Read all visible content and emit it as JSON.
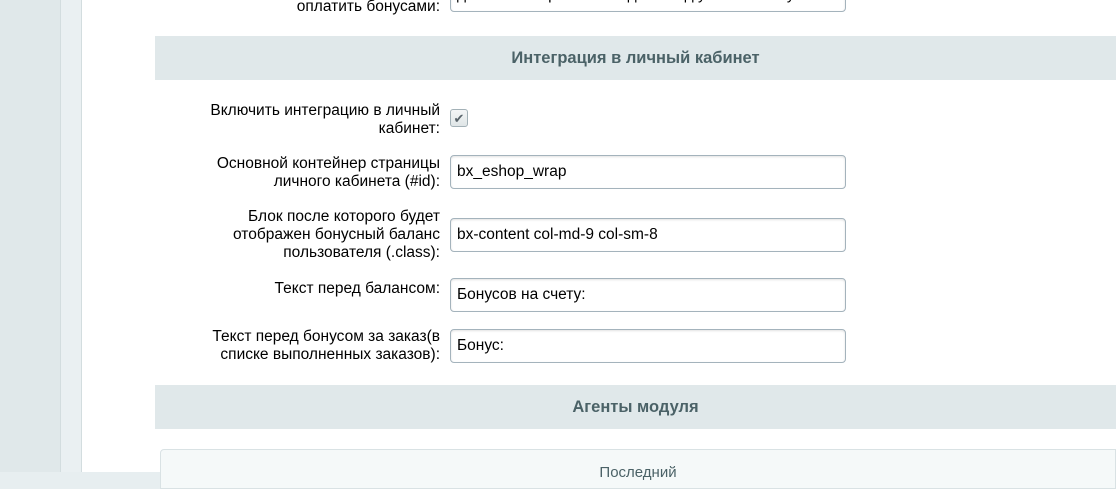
{
  "top_row": {
    "label": "оплатить бонусами:",
    "value": "данные товары не попадают под условия бонусной"
  },
  "section_integration": {
    "title": "Интеграция в личный кабинет"
  },
  "fields": {
    "enable": {
      "label_l1": "Включить интеграцию в личный",
      "label_l2": "кабинет:",
      "checked": true
    },
    "container": {
      "label_l1": "Основной контейнер страницы",
      "label_l2": "личного кабинета (#id):",
      "value": "bx_eshop_wrap"
    },
    "block": {
      "label_l1": "Блок после которого будет",
      "label_l2": "отображен бонусный баланс",
      "label_l3": "пользователя (.class):",
      "value": "bx-content col-md-9 col-sm-8"
    },
    "balance_text": {
      "label": "Текст перед балансом:",
      "value": "Бонусов на счету:"
    },
    "order_bonus_text": {
      "label_l1": "Текст перед бонусом за заказ(в",
      "label_l2": "списке выполненных заказов):",
      "value": "Бонус:"
    }
  },
  "section_agents": {
    "title": "Агенты модуля"
  },
  "agents_card": {
    "title": "Последний"
  },
  "icons": {
    "checkbox": "check-icon"
  }
}
